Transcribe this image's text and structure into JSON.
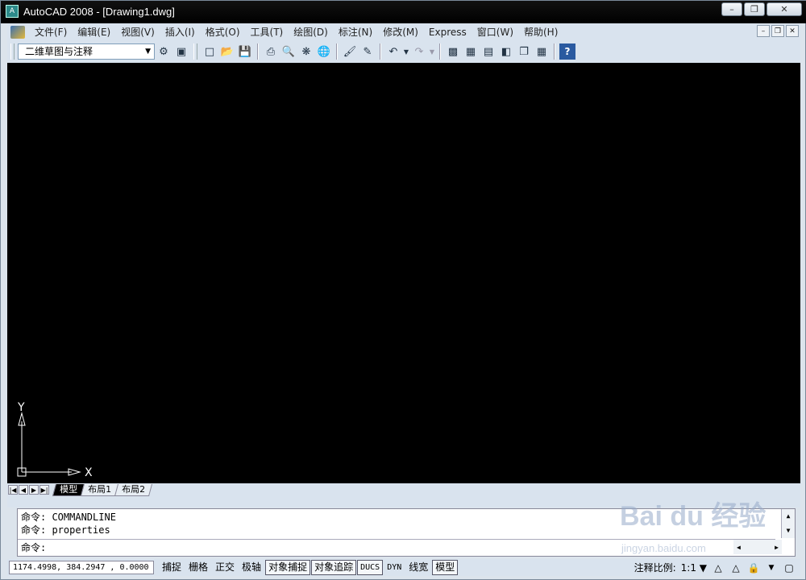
{
  "window": {
    "title": "AutoCAD 2008 - [Drawing1.dwg]"
  },
  "menu": {
    "items": [
      "文件(F)",
      "编辑(E)",
      "视图(V)",
      "插入(I)",
      "格式(O)",
      "工具(T)",
      "绘图(D)",
      "标注(N)",
      "修改(M)",
      "Express",
      "窗口(W)",
      "帮助(H)"
    ]
  },
  "toolbar": {
    "workspace_value": "二维草图与注释",
    "icons": [
      "workspace-settings-icon",
      "my-workspace-icon",
      "new-icon",
      "open-icon",
      "save-icon",
      "plot-icon",
      "plot-preview-icon",
      "publish-icon",
      "3d-dwf-icon",
      "match-properties-icon",
      "block-editor-icon",
      "undo-icon",
      "redo-icon",
      "properties-icon",
      "design-center-icon",
      "tool-palettes-icon",
      "sheet-set-icon",
      "markup-icon",
      "quickcalc-icon",
      "help-icon"
    ]
  },
  "ucs": {
    "x_label": "X",
    "y_label": "Y"
  },
  "layout_tabs": [
    "模型",
    "布局1",
    "布局2"
  ],
  "command": {
    "history": [
      "命令: COMMANDLINE",
      "命令: properties"
    ],
    "prompt": "命令:"
  },
  "status": {
    "coordinates": "1174.4998,  384.2947 ,  0.0000",
    "toggles": [
      {
        "label": "捕捉",
        "on": false
      },
      {
        "label": "栅格",
        "on": false
      },
      {
        "label": "正交",
        "on": false
      },
      {
        "label": "极轴",
        "on": false
      },
      {
        "label": "对象捕捉",
        "on": true
      },
      {
        "label": "对象追踪",
        "on": true
      },
      {
        "label": "DUCS",
        "on": true
      },
      {
        "label": "DYN",
        "on": false
      },
      {
        "label": "线宽",
        "on": false
      },
      {
        "label": "模型",
        "on": true
      }
    ],
    "annotation_scale_label": "注释比例:",
    "annotation_scale_value": "1:1"
  },
  "watermark": {
    "main": "Bai du 经验",
    "sub": "jingyan.baidu.com"
  },
  "colors": {
    "canvas": "#000000",
    "chrome": "#d9e3ee"
  }
}
